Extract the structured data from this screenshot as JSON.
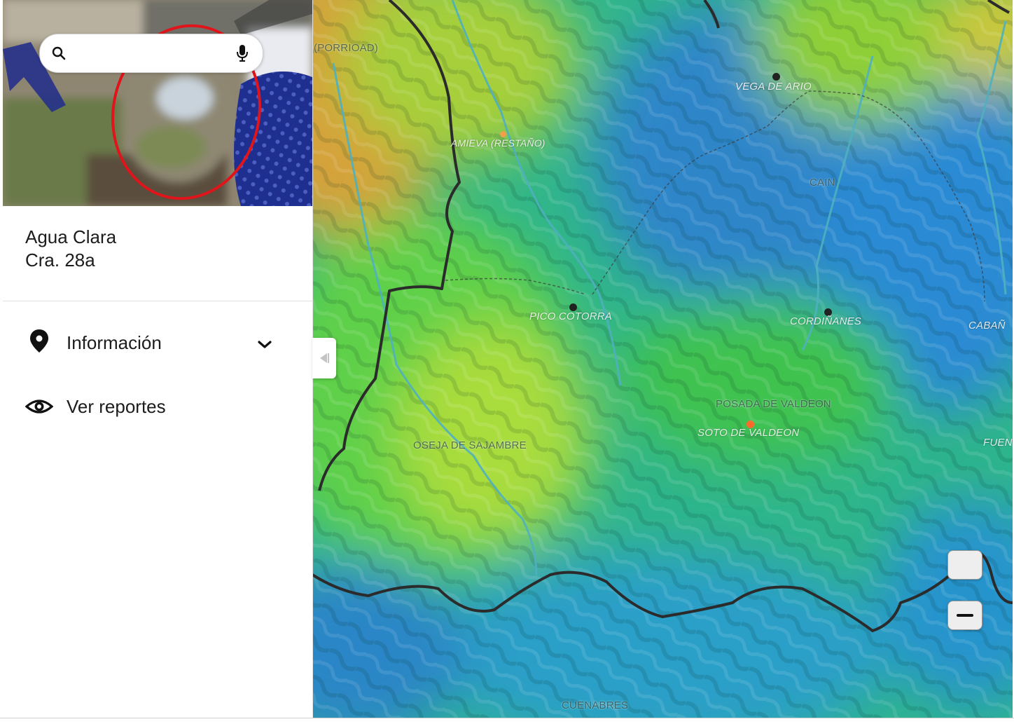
{
  "search": {
    "placeholder": "",
    "value": ""
  },
  "location": {
    "line1": "Agua Clara",
    "line2": "Cra. 28a"
  },
  "menu": {
    "info_label": "Información",
    "reports_label": "Ver reportes"
  },
  "icons": {
    "search": "search-icon",
    "mic": "microphone-icon",
    "info": "location-pin-icon",
    "info_toggle": "chevron-down-icon",
    "reports": "eye-icon",
    "collapse": "triangle-left-icon",
    "zoom_out": "minus-icon"
  },
  "map": {
    "places": {
      "porriado": "(PORRIOAD)",
      "amieva": "AMIEVA (RESTAÑO)",
      "vega_de_ario": "VEGA DE ARIO",
      "cain": "CAIN",
      "pico_cotorra": "PICO COTORRA",
      "cordinanes": "CORDIÑANES",
      "cabana": "CABAÑ",
      "posada": "POSADA DE VALDEON",
      "soto": "SOTO DE VALDEON",
      "oseja": "OSEJA DE SAJAMBRE",
      "fuen": "FUEN",
      "cuenabres": "CUENABRES"
    }
  },
  "colors": {
    "panel_bg": "#ffffff",
    "photo_circle": "#e0141a",
    "map_green": "#35c25a",
    "map_blue": "#2a8fd0",
    "border_line": "#2b2b2b"
  }
}
